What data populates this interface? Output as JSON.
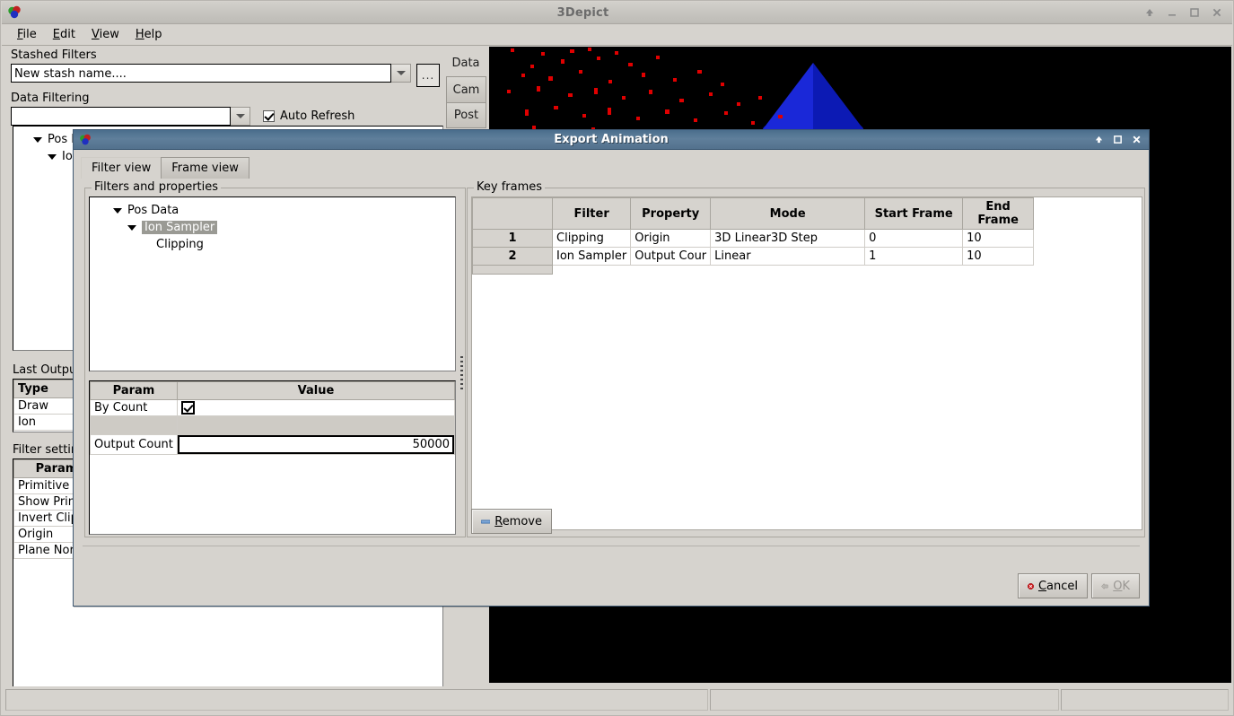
{
  "app": {
    "title": "3Depict",
    "window_buttons": [
      "shade",
      "minimize",
      "maximize",
      "close"
    ]
  },
  "menubar": {
    "items": [
      {
        "label": "File",
        "mnemonic": "F"
      },
      {
        "label": "Edit",
        "mnemonic": "E"
      },
      {
        "label": "View",
        "mnemonic": "V"
      },
      {
        "label": "Help",
        "mnemonic": "H"
      }
    ]
  },
  "left_panel": {
    "stashed_filters": {
      "label": "Stashed Filters",
      "value": "New stash name....",
      "dropdown_icon": "chevron-down-icon",
      "more_button": "..."
    },
    "data_filtering": {
      "label": "Data Filtering",
      "value": "",
      "dropdown_icon": "chevron-down-icon"
    },
    "auto_refresh": {
      "label": "Auto Refresh",
      "checked": true
    },
    "side_tabs": [
      {
        "label": "Data",
        "selected": true
      },
      {
        "label": "Cam",
        "selected": false
      },
      {
        "label": "Post",
        "selected": false
      }
    ],
    "filter_tree": [
      {
        "label": "Pos Data",
        "depth": 0,
        "expander": true
      },
      {
        "label": "Ion",
        "depth": 1,
        "expander": true
      }
    ],
    "last_output": {
      "label": "Last Output",
      "column": "Type",
      "rows": [
        "Draw",
        "Ion"
      ]
    },
    "filter_settings": {
      "label": "Filter settings",
      "column": "Param",
      "rows": [
        "Primitive",
        "Show Prim",
        "Invert Clip",
        "Origin",
        "Plane Nor"
      ]
    }
  },
  "view3d": {
    "background": "#000000",
    "point_color": "#e00000",
    "marker_color": "#0020d0",
    "marker_shape": "cone"
  },
  "statusbar": {
    "cells": [
      "",
      "",
      ""
    ]
  },
  "dialog": {
    "title": "Export Animation",
    "icon": "app-icon",
    "window_buttons": [
      "shade",
      "maximize",
      "close"
    ],
    "tabs": [
      {
        "label": "Filter view",
        "active": true
      },
      {
        "label": "Frame view",
        "active": false
      }
    ],
    "filters_box": {
      "title": "Filters and properties",
      "tree": [
        {
          "label": "Pos Data",
          "depth": 0,
          "expander": true,
          "selected": false
        },
        {
          "label": "Ion Sampler",
          "depth": 1,
          "expander": true,
          "selected": true
        },
        {
          "label": "Clipping",
          "depth": 2,
          "expander": false,
          "selected": false
        }
      ]
    },
    "params_table": {
      "headers": [
        "Param",
        "Value"
      ],
      "rows": [
        {
          "param": "By Count",
          "value": "",
          "type": "checkbox",
          "checked": true
        },
        {
          "param": "",
          "value": "",
          "type": "blank"
        },
        {
          "param": "Output Count",
          "value": "50000",
          "type": "text"
        }
      ]
    },
    "keyframes_box": {
      "title": "Key frames",
      "headers": [
        "",
        "Filter",
        "Property",
        "Mode",
        "Start Frame",
        "End Frame"
      ],
      "rows": [
        {
          "n": "1",
          "filter": "Clipping",
          "property": "Origin",
          "mode": "3D Linear3D Step",
          "start": "0",
          "end": "10"
        },
        {
          "n": "2",
          "filter": "Ion Sampler",
          "property": "Output Cour",
          "mode": "Linear",
          "start": "1",
          "end": "10"
        }
      ]
    },
    "remove_button": {
      "label": "Remove",
      "mnemonic": "R",
      "icon": "minus-icon"
    },
    "cancel_button": {
      "label": "Cancel",
      "mnemonic": "C",
      "icon": "cancel-icon"
    },
    "ok_button": {
      "label": "OK",
      "mnemonic": "O",
      "icon": "check-arrow-icon",
      "disabled": true
    }
  }
}
